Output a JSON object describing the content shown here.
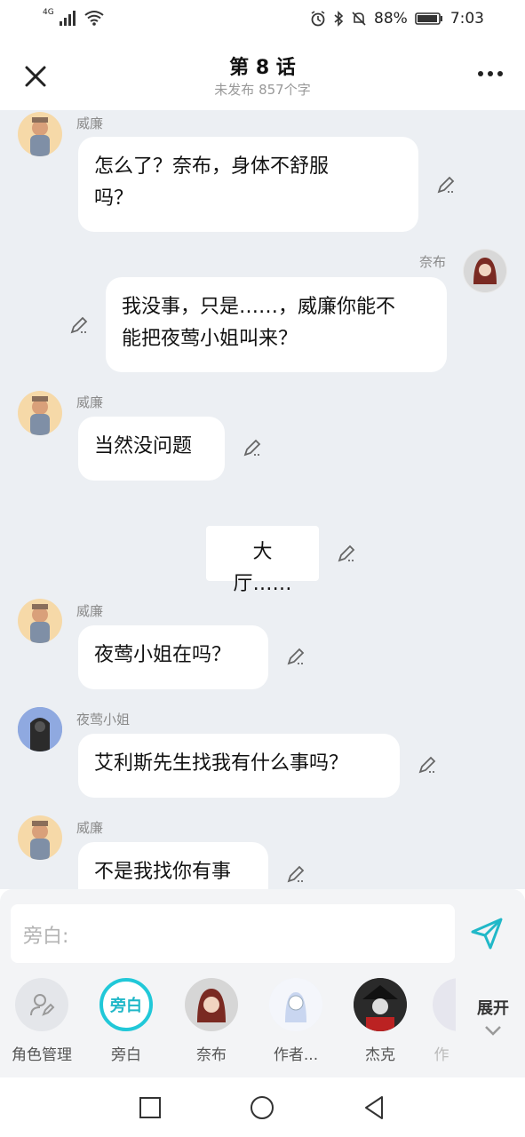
{
  "status": {
    "network": "4G",
    "battery": "88%",
    "time": "7:03"
  },
  "header": {
    "title": "第 8 话",
    "subtitle": "未发布 857个字"
  },
  "messages": [
    {
      "speaker": "威廉",
      "text_lines": [
        "怎么了？奈布，身体不舒服",
        "吗？"
      ]
    },
    {
      "speaker": "奈布",
      "text_lines": [
        "我没事，只是……，威廉你能不",
        "能把夜莺小姐叫来？"
      ]
    },
    {
      "speaker": "威廉",
      "text_lines": [
        "当然没问题"
      ]
    },
    {
      "narration": "大厅……"
    },
    {
      "speaker": "威廉",
      "text_lines": [
        "夜莺小姐在吗？"
      ]
    },
    {
      "speaker": "夜莺小姐",
      "text_lines": [
        "艾利斯先生找我有什么事吗？"
      ]
    },
    {
      "speaker": "威廉",
      "text_lines": [
        "不是我找你有事"
      ]
    }
  ],
  "input": {
    "placeholder": "旁白:"
  },
  "roles": [
    {
      "label": "角色管理",
      "icon": "person-edit-icon"
    },
    {
      "label": "旁白",
      "badge": "旁白"
    },
    {
      "label": "奈布"
    },
    {
      "label": "作者..."
    },
    {
      "label": "杰克"
    },
    {
      "label": "作"
    }
  ],
  "expand_label": "展开"
}
